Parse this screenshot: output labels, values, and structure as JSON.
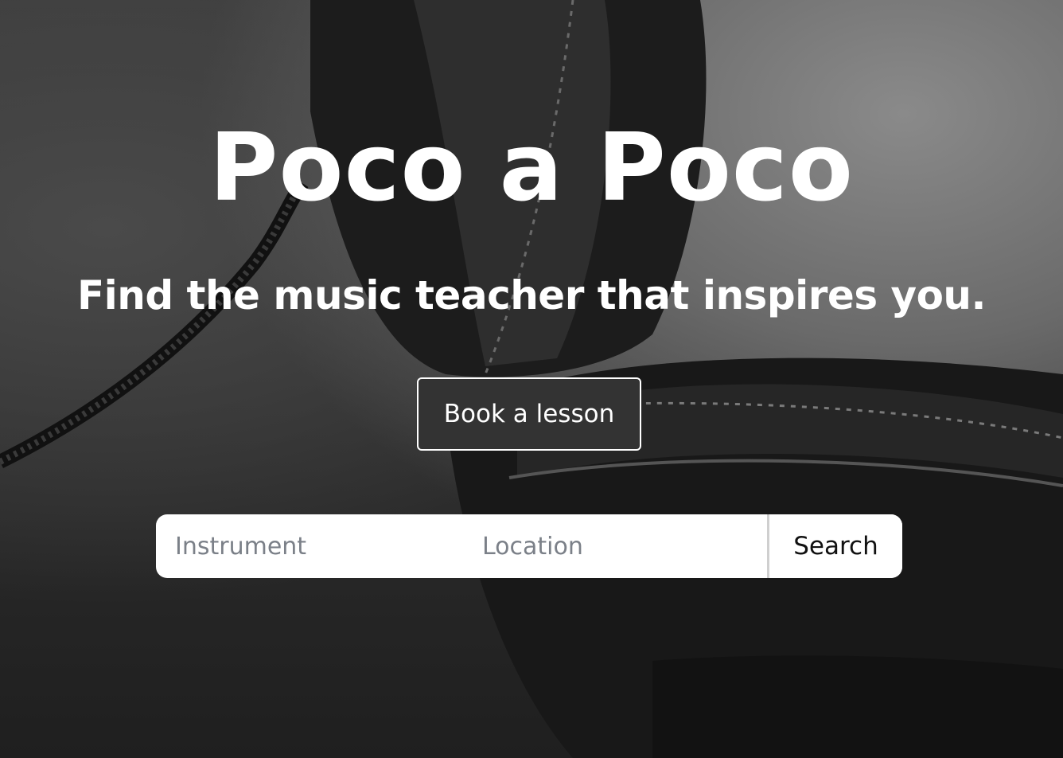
{
  "hero": {
    "title": "Poco a Poco",
    "subtitle": "Find the music teacher that inspires you.",
    "background_icon": "headphones-photo"
  },
  "cta": {
    "label": "Book a lesson"
  },
  "search": {
    "instrument_placeholder": "Instrument",
    "instrument_value": "",
    "location_placeholder": "Location",
    "location_value": "",
    "button_label": "Search"
  },
  "colors": {
    "text": "#ffffff",
    "button_bg": "#333333",
    "placeholder": "#7b8088"
  }
}
